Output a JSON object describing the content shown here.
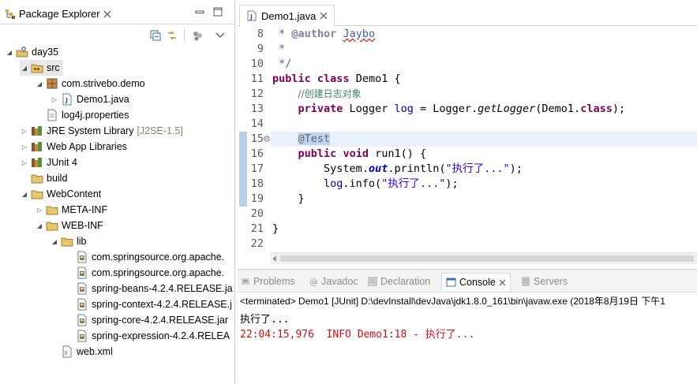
{
  "package_explorer": {
    "tab_label": "Package Explorer",
    "tree": [
      {
        "label": "day35",
        "level": 0,
        "twisty": "expanded",
        "icon": "project-icon"
      },
      {
        "label": "src",
        "level": 1,
        "twisty": "expanded",
        "icon": "source-folder-icon",
        "selected": true
      },
      {
        "label": "com.strivebo.demo",
        "level": 2,
        "twisty": "expanded",
        "icon": "package-icon"
      },
      {
        "label": "Demo1.java",
        "level": 3,
        "twisty": "collapsed",
        "icon": "java-file-icon"
      },
      {
        "label": "log4j.properties",
        "level": 2,
        "twisty": "none",
        "icon": "properties-file-icon"
      },
      {
        "label": "JRE System Library",
        "decoration": "[J2SE-1.5]",
        "level": 1,
        "twisty": "collapsed",
        "icon": "library-icon"
      },
      {
        "label": "Web App Libraries",
        "level": 1,
        "twisty": "collapsed",
        "icon": "library-icon"
      },
      {
        "label": "JUnit 4",
        "level": 1,
        "twisty": "collapsed",
        "icon": "library-icon"
      },
      {
        "label": "build",
        "level": 1,
        "twisty": "none",
        "icon": "folder-icon"
      },
      {
        "label": "WebContent",
        "level": 1,
        "twisty": "expanded",
        "icon": "folder-icon"
      },
      {
        "label": "META-INF",
        "level": 2,
        "twisty": "collapsed",
        "icon": "folder-icon"
      },
      {
        "label": "WEB-INF",
        "level": 2,
        "twisty": "expanded",
        "icon": "folder-icon"
      },
      {
        "label": "lib",
        "level": 3,
        "twisty": "expanded",
        "icon": "folder-icon"
      },
      {
        "label": "com.springsource.org.apache.",
        "level": 4,
        "twisty": "none",
        "icon": "jar-file-icon"
      },
      {
        "label": "com.springsource.org.apache.",
        "level": 4,
        "twisty": "none",
        "icon": "jar-file-icon"
      },
      {
        "label": "spring-beans-4.2.4.RELEASE.ja",
        "level": 4,
        "twisty": "none",
        "icon": "jar-file-icon"
      },
      {
        "label": "spring-context-4.2.4.RELEASE.j",
        "level": 4,
        "twisty": "none",
        "icon": "jar-file-icon"
      },
      {
        "label": "spring-core-4.2.4.RELEASE.jar",
        "level": 4,
        "twisty": "none",
        "icon": "jar-file-icon"
      },
      {
        "label": "spring-expression-4.2.4.RELEA",
        "level": 4,
        "twisty": "none",
        "icon": "jar-file-icon"
      },
      {
        "label": "web.xml",
        "level": 3,
        "twisty": "none",
        "icon": "xml-file-icon"
      }
    ]
  },
  "editor": {
    "tab_label": "Demo1.java",
    "line_numbers": [
      "8",
      "9",
      "10",
      "11",
      "12",
      "13",
      "14",
      "15",
      "16",
      "17",
      "18",
      "19",
      "20",
      "21",
      "22"
    ],
    "code": {
      "l8_star": " * ",
      "l8_tag": "@author",
      "l8_sp": " ",
      "l8_name": "Jaybo",
      "l9": " *",
      "l10": " */",
      "l11_kw1": "public",
      "l11_sp1": " ",
      "l11_kw2": "class",
      "l11_rest": " Demo1 {",
      "l12_indent": "    ",
      "l12_comment": "//创建日志对象",
      "l13_indent": "    ",
      "l13_kw": "private",
      "l13_type": " Logger ",
      "l13_field": "log",
      "l13_eq": " = Logger.",
      "l13_method": "getLogger",
      "l13_arg": "(Demo1.",
      "l13_kw2": "class",
      "l13_end": ");",
      "l15_indent": "    ",
      "l15_anno": "@Test",
      "l16_indent": "    ",
      "l16_kw1": "public",
      "l16_sp": " ",
      "l16_kw2": "void",
      "l16_rest": " run1() {",
      "l17_indent": "        ",
      "l17_a": "System.",
      "l17_out": "out",
      "l17_b": ".println(",
      "l17_str": "\"执行了...\"",
      "l17_end": ");",
      "l18_indent": "        ",
      "l18_field": "log",
      "l18_b": ".info(",
      "l18_str": "\"执行了...\"",
      "l18_end": ");",
      "l19": "    }",
      "l21": "}"
    }
  },
  "console": {
    "tabs": [
      {
        "label": "Problems",
        "icon": "problems-icon"
      },
      {
        "label": "Javadoc",
        "icon": "javadoc-icon"
      },
      {
        "label": "Declaration",
        "icon": "declaration-icon"
      },
      {
        "label": "Console",
        "icon": "console-icon",
        "active": true
      },
      {
        "label": "Servers",
        "icon": "servers-icon"
      }
    ],
    "status": "<terminated> Demo1 [JUnit] D:\\devInstall\\devJava\\jdk1.8.0_161\\bin\\javaw.exe (2018年8月19日 下午1",
    "output": [
      "执行了...",
      "22:04:15,976  INFO Demo1:18 - 执行了..."
    ]
  },
  "colors": {
    "keyword": "#7f0055",
    "comment": "#3f7f5f",
    "javadoc": "#3f5fbf",
    "string": "#2a00ff",
    "field": "#0000c0",
    "error": "#d01010"
  }
}
